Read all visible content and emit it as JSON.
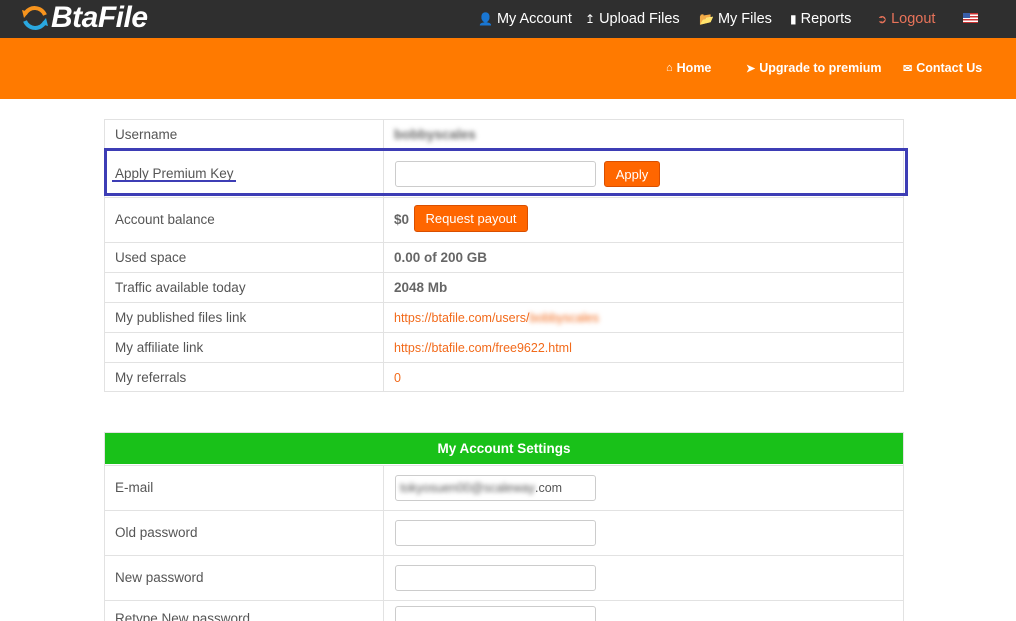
{
  "brand": {
    "name": "BtaFile"
  },
  "topnav": {
    "my_account": "My Account",
    "upload_files": "Upload Files",
    "my_files": "My Files",
    "reports": "Reports",
    "logout": "Logout"
  },
  "subnav": {
    "home": "Home",
    "upgrade": "Upgrade to premium",
    "contact": "Contact Us"
  },
  "account": {
    "username_label": "Username",
    "username_value": "bobbyscales",
    "premium_key_label": "Apply Premium Key",
    "apply_label": "Apply",
    "balance_label": "Account balance",
    "balance_value": "$0",
    "payout_label": "Request payout",
    "used_space_label": "Used space",
    "used_space_value": "0.00 of 200 GB",
    "traffic_label": "Traffic available today",
    "traffic_value": "2048 Mb",
    "published_label": "My published files link",
    "published_prefix": "https://btafile.com/users/",
    "published_suffix": "bobbyscales",
    "affiliate_label": "My affiliate link",
    "affiliate_value": "https://btafile.com/free9622.html",
    "referrals_label": "My referrals",
    "referrals_value": "0"
  },
  "settings": {
    "title": "My Account Settings",
    "email_label": "E-mail",
    "email_blurred": "tokyosuen00@scaleway",
    "email_suffix": ".com",
    "old_password_label": "Old password",
    "new_password_label": "New password",
    "retype_label": "Retype New password"
  },
  "colors": {
    "orange": "#ff7a00",
    "green": "#19c119",
    "highlight": "#3d3db5"
  }
}
